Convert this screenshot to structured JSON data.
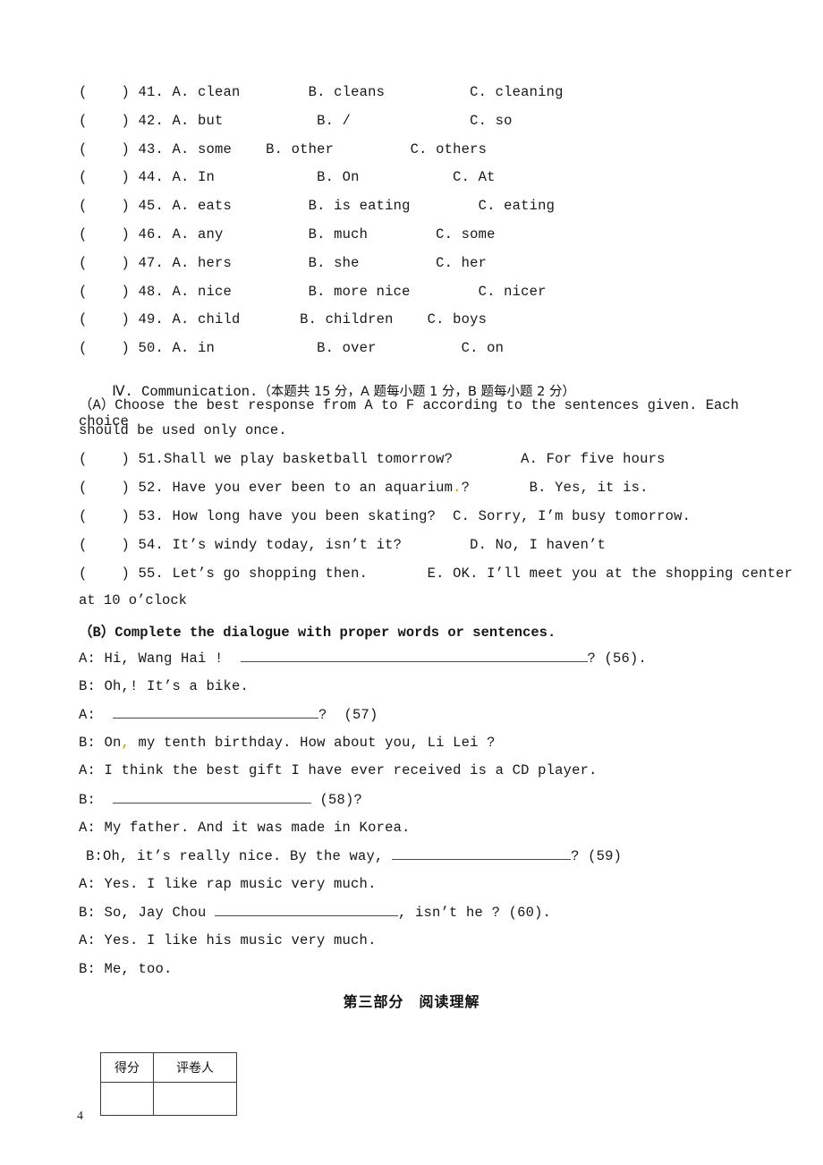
{
  "page": {
    "number": "4"
  },
  "multiple_choice": {
    "rows": [
      {
        "bracket_open": "(",
        "bracket_close": ")",
        "number": "41.",
        "a": "A. clean",
        "b": "B. cleans",
        "c": "C. cleaning",
        "gap_a": 8,
        "gap_b": 10
      },
      {
        "bracket_open": "(",
        "bracket_close": ")",
        "number": "42.",
        "a": "A. but",
        "b": "B. /",
        "c": "C. so",
        "gap_a": 11,
        "gap_b": 14
      },
      {
        "bracket_open": "(",
        "bracket_close": ")",
        "number": "43.",
        "a": "A. some",
        "b": "B. other",
        "c": "C. others",
        "gap_a": 4,
        "gap_b": 9
      },
      {
        "bracket_open": "(",
        "bracket_close": ")",
        "number": "44.",
        "a": "A. In",
        "b": "B. On",
        "c": "C. At",
        "gap_a": 12,
        "gap_b": 11
      },
      {
        "bracket_open": "(",
        "bracket_close": ")",
        "number": "45.",
        "a": "A. eats",
        "b": "B. is eating",
        "c": "C. eating",
        "gap_a": 9,
        "gap_b": 8
      },
      {
        "bracket_open": "(",
        "bracket_close": ")",
        "number": "46.",
        "a": "A. any",
        "b": "B. much",
        "c": "C. some",
        "gap_a": 10,
        "gap_b": 8
      },
      {
        "bracket_open": "(",
        "bracket_close": ")",
        "number": "47.",
        "a": "A. hers",
        "b": "B. she",
        "c": "C. her",
        "gap_a": 9,
        "gap_b": 9
      },
      {
        "bracket_open": "(",
        "bracket_close": ")",
        "number": "48.",
        "a": "A. nice",
        "b": "B. more nice",
        "c": "C. nicer",
        "gap_a": 9,
        "gap_b": 8
      },
      {
        "bracket_open": "(",
        "bracket_close": ")",
        "number": "49.",
        "a": "A. child",
        "b": "B. children",
        "c": "C. boys",
        "gap_a": 7,
        "gap_b": 4
      },
      {
        "bracket_open": "(",
        "bracket_close": ")",
        "number": "50.",
        "a": "A. in",
        "b": "B. over",
        "c": "C. on",
        "gap_a": 12,
        "gap_b": 10
      }
    ]
  },
  "section_iv": {
    "numeral": "Ⅳ",
    "title": ". Communication.",
    "score_note": "（本题共 15 分，A 题每小题 1 分，B 题每小题 2 分）",
    "part_a_instruction_line1": "（A）Choose the best response from A to F according to the sentences given. Each choice",
    "part_a_instruction_line2": "should be used only once.",
    "items": [
      {
        "bracket_open": "(",
        "bracket_close": ")",
        "number": "51.",
        "prompt": "Shall we play basketball tomorrow?",
        "choice": "A. For five hours",
        "gap": 8,
        "lead_space": ""
      },
      {
        "bracket_open": "(",
        "bracket_close": ")",
        "number": "52.",
        "prompt": "Have you ever been to an aquarium",
        "prompt_marker": ".",
        "prompt_tail": "?",
        "choice": "B. Yes, it is.",
        "gap": 7,
        "lead_space": " "
      },
      {
        "bracket_open": "(",
        "bracket_close": ")",
        "number": "53.",
        "prompt": "How long have you been skating?",
        "choice": "C. Sorry, I’m busy tomorrow.",
        "gap": 2,
        "lead_space": " "
      },
      {
        "bracket_open": "(",
        "bracket_close": ")",
        "number": "54.",
        "prompt": "It’s windy today, isn’t it?",
        "choice": "D. No, I haven’t",
        "gap": 8,
        "lead_space": " "
      },
      {
        "bracket_open": "(",
        "bracket_close": ")",
        "number": "55.",
        "prompt": "Let’s go shopping then.",
        "choice": "E. OK. I’ll meet you at the shopping center",
        "gap": 7,
        "lead_space": " "
      }
    ],
    "item_55_wrap": "at 10 o’clock",
    "part_b_instruction": "（B）Complete the dialogue with proper words or sentences."
  },
  "dialogue": {
    "lines": [
      {
        "id": "line-56",
        "speaker": "A:",
        "before": " Hi, Wang Hai !  ",
        "blank_width": 388,
        "after": "? (56).",
        "indent": 0
      },
      {
        "id": "line-bike",
        "speaker": "B:",
        "before": " Oh,",
        "marker": "",
        "after_plain": "! It’s a bike.",
        "blank_width": 0,
        "indent": 0
      },
      {
        "id": "line-57",
        "speaker": "A:",
        "before": "  ",
        "blank_width": 230,
        "after": "?  (57)",
        "indent": 0
      },
      {
        "id": "line-birthday",
        "speaker": "B:",
        "before": " On",
        "marker": ",",
        "after_plain": " my tenth birthday. How about you, Li Lei ?",
        "blank_width": 0,
        "indent": 0
      },
      {
        "id": "line-gift",
        "speaker": "A:",
        "before": " I think the best gift I have ever received is a CD player.",
        "blank_width": 0,
        "after": "",
        "indent": 0
      },
      {
        "id": "line-58",
        "speaker": "B:",
        "before": "  ",
        "blank_width": 222,
        "after": " (58)?",
        "indent": 0
      },
      {
        "id": "line-father",
        "speaker": "A:",
        "before": " My father. And it was made in Korea.",
        "blank_width": 0,
        "after": "",
        "indent": 0
      },
      {
        "id": "line-59",
        "speaker": "B:Oh,",
        "before": " it’s really nice. By the way, ",
        "blank_width": 200,
        "after": "? (59)",
        "indent": 8
      },
      {
        "id": "line-rap",
        "speaker": "A:",
        "before": " Yes. I like rap music very much.",
        "blank_width": 0,
        "after": "",
        "indent": 0
      },
      {
        "id": "line-60",
        "speaker": "B:",
        "before": " So, Jay Chou ",
        "blank_width": 205,
        "after": ", isn’t he ? (60).",
        "indent": 0
      },
      {
        "id": "line-his-music",
        "speaker": "A:",
        "before": " Yes. I like his music very much.",
        "blank_width": 0,
        "after": "",
        "indent": 0
      },
      {
        "id": "line-me-too",
        "speaker": "B:",
        "before": " Me, too.",
        "blank_width": 0,
        "after": "",
        "indent": 0
      }
    ]
  },
  "part_three": {
    "heading": "第三部分　阅读理解"
  },
  "score_table": {
    "headers": [
      "得分",
      "评卷人"
    ],
    "values": [
      "",
      ""
    ]
  },
  "colors": {
    "text": "#171717",
    "marker": "#b8960c",
    "rule": "#4a4a4a",
    "table_border": "#3a3a3a"
  }
}
